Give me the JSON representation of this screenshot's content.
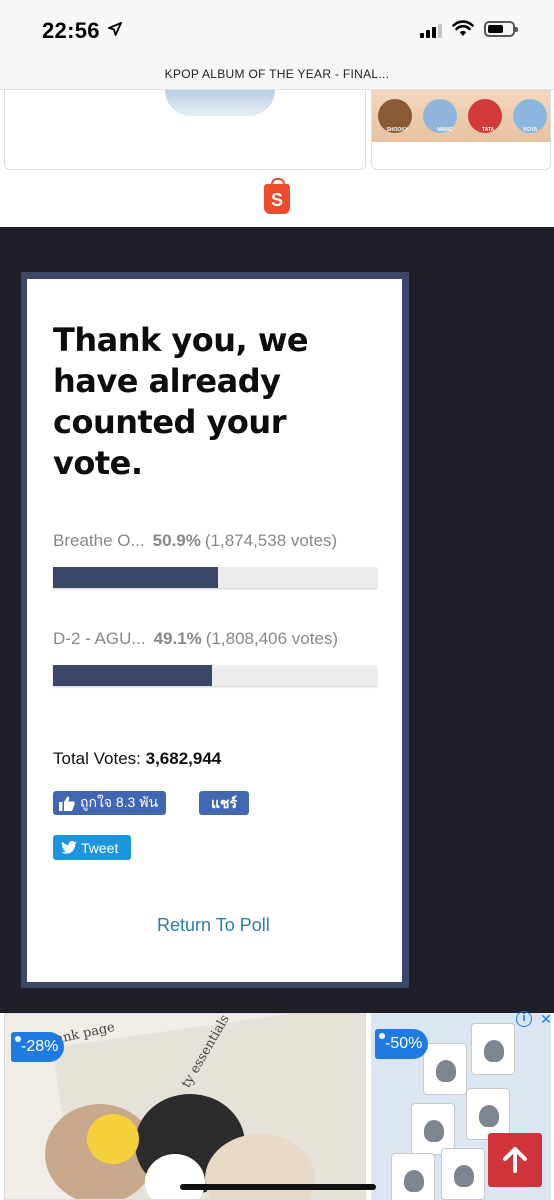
{
  "status_bar": {
    "time": "22:56",
    "battery_level": 0.65,
    "signal_bars_filled": 3,
    "signal_bars_total": 4
  },
  "browser": {
    "title": "KPOP ALBUM OF THE YEAR - FINAL..."
  },
  "top_ad": {
    "figure_labels": [
      "SHOOKY",
      "MANG",
      "TATA",
      "KOYA"
    ],
    "shop_logo_letter": "S"
  },
  "poll": {
    "heading": "Thank you, we have already counted your vote.",
    "options": [
      {
        "label": "Breathe O...",
        "percent": "50.9%",
        "votes": "(1,874,538 votes)",
        "share": 0.509
      },
      {
        "label": "D-2 - AGU...",
        "percent": "49.1%",
        "votes": "(1,808,406 votes)",
        "share": 0.491
      }
    ],
    "total_label": "Total Votes:",
    "total_value": "3,682,944",
    "like_label": "ถูกใจ 8.3 พัน",
    "share_label": "แชร์",
    "tweet_label": "Tweet",
    "return_label": "Return To Poll",
    "bar_color": "#3b4766"
  },
  "bottom_ads": {
    "left": {
      "discount": "-28%",
      "paper_text_1": "ank page",
      "paper_text_2": "ty essentials"
    },
    "right": {
      "discount": "-50%"
    }
  },
  "colors": {
    "dark_background": "#1f1f29",
    "accent_link": "#2f7ea6",
    "facebook_blue": "#4267b2",
    "twitter_blue": "#1b95e0",
    "shopee_orange": "#ee4d2d",
    "back_to_top_red": "#d0343a"
  }
}
